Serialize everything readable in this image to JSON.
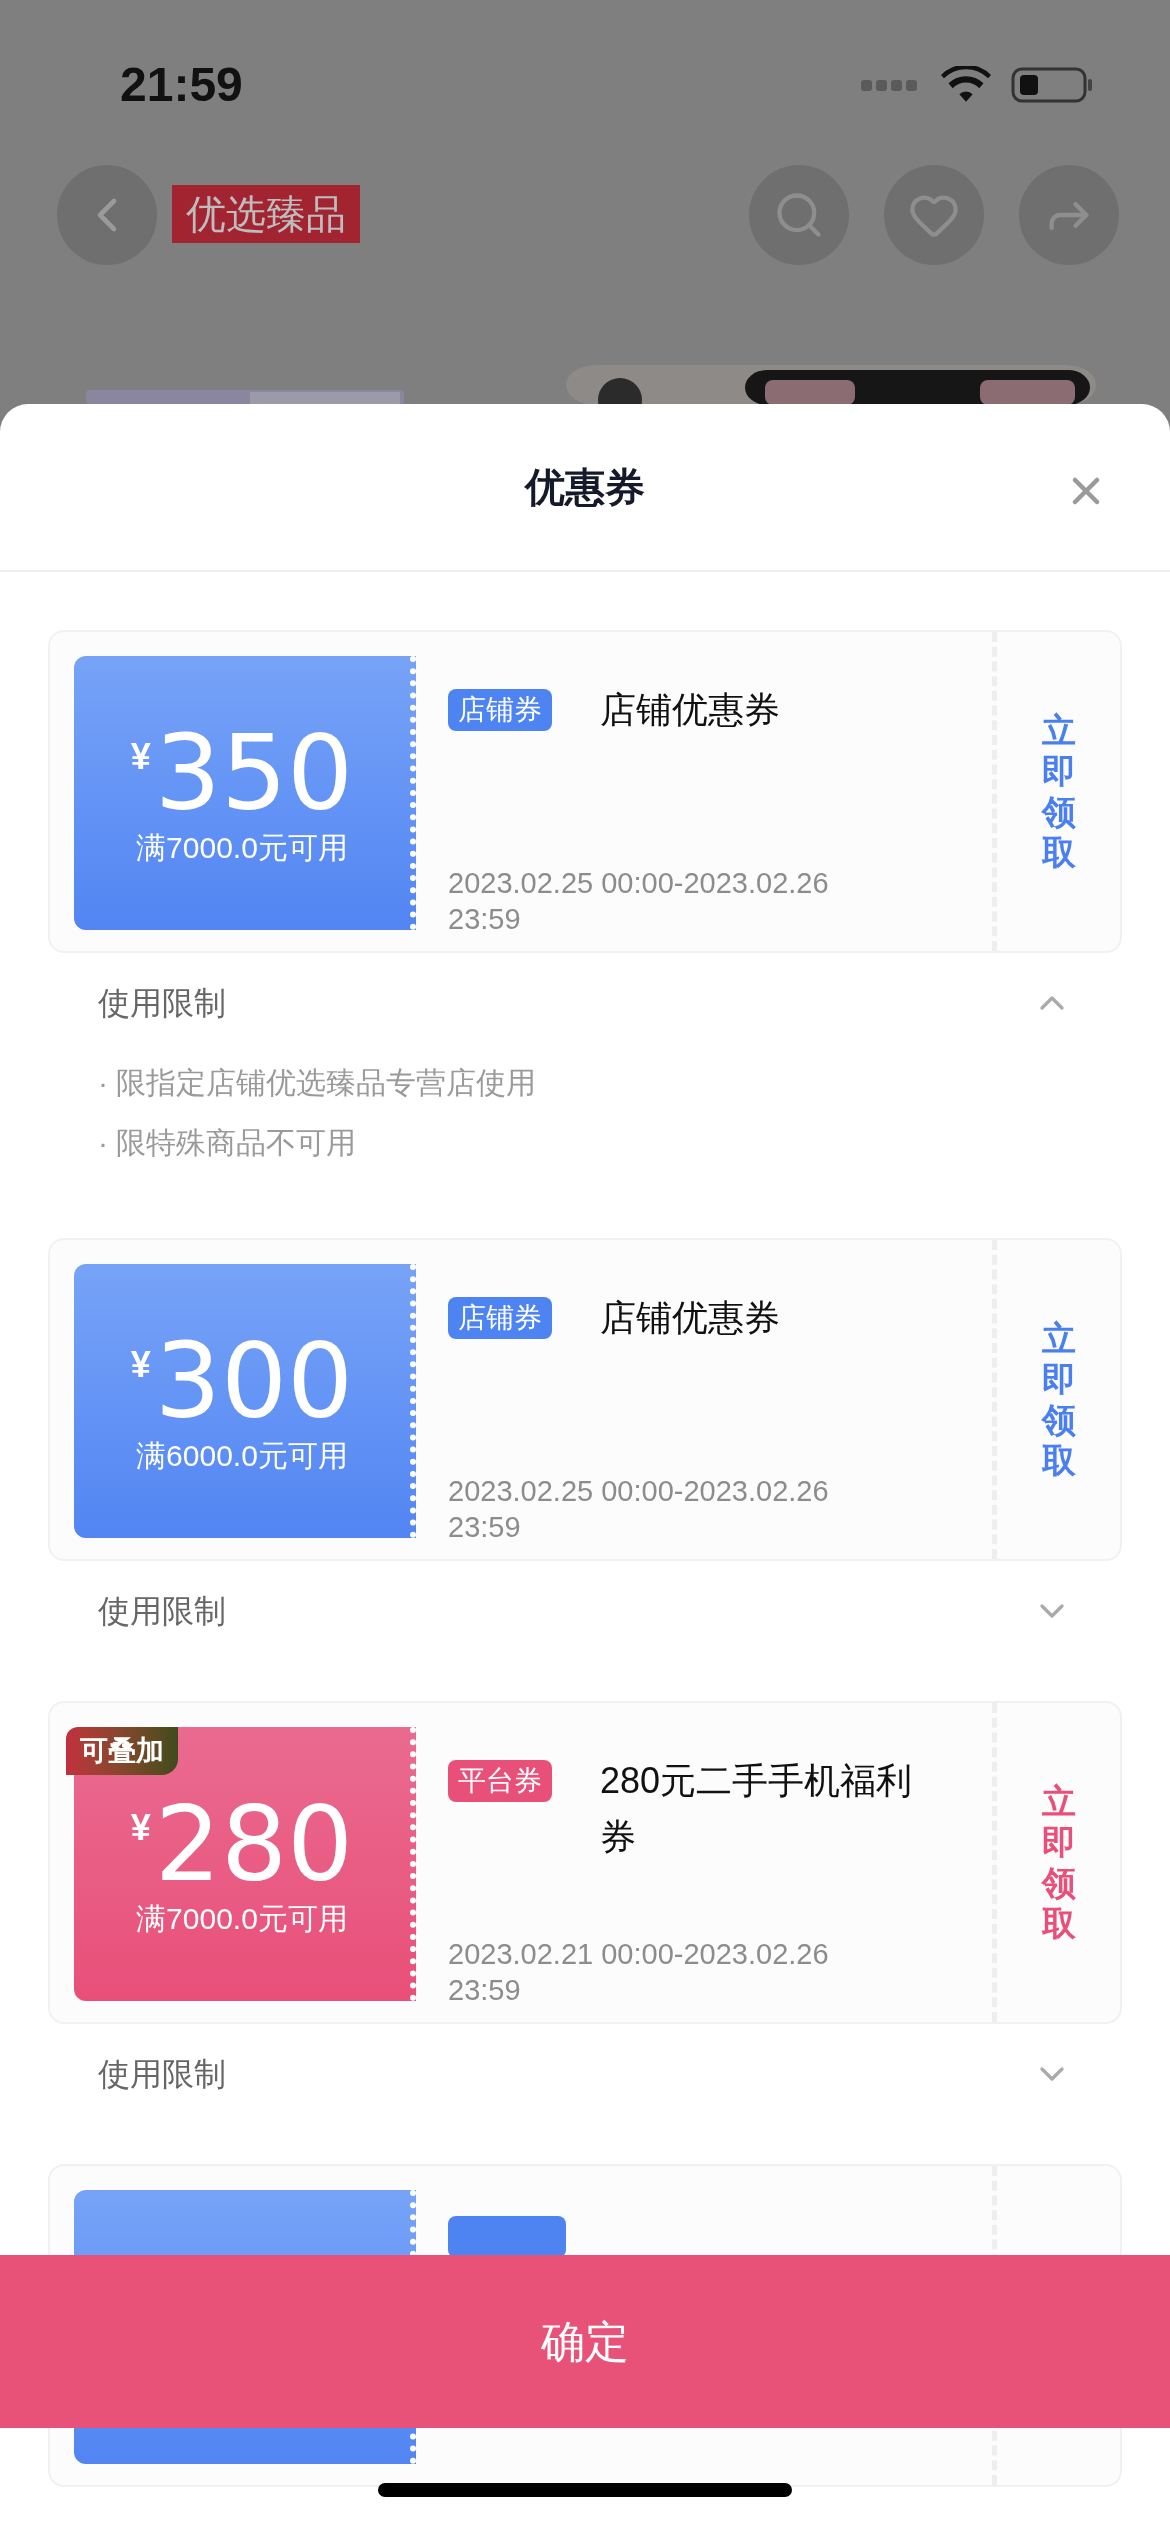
{
  "status_bar": {
    "time": "21:59"
  },
  "background_page": {
    "brand_label": "优选臻品"
  },
  "sheet": {
    "title": "优惠券",
    "coupons": [
      {
        "kind": "store",
        "currency": "¥",
        "amount": "350",
        "condition": "满7000.0元可用",
        "tag": "店铺券",
        "name": "店铺优惠券",
        "validity": "2023.02.25 00:00-2023.02.26 23:59",
        "claim": "立即领取",
        "limits": {
          "label": "使用限制",
          "expanded": true,
          "rules": [
            "· 限指定店铺优选臻品专营店使用",
            "· 限特殊商品不可用"
          ]
        }
      },
      {
        "kind": "store",
        "currency": "¥",
        "amount": "300",
        "condition": "满6000.0元可用",
        "tag": "店铺券",
        "name": "店铺优惠券",
        "validity": "2023.02.25 00:00-2023.02.26 23:59",
        "claim": "立即领取",
        "limits": {
          "label": "使用限制",
          "expanded": false
        }
      },
      {
        "kind": "platform",
        "badge": "可叠加",
        "currency": "¥",
        "amount": "280",
        "condition": "满7000.0元可用",
        "tag": "平台券",
        "name": "280元二手手机福利券",
        "validity": "2023.02.21 00:00-2023.02.26 23:59",
        "claim": "立即领取",
        "limits": {
          "label": "使用限制",
          "expanded": false
        }
      },
      {
        "kind": "store"
      }
    ],
    "confirm_button": "确定"
  }
}
